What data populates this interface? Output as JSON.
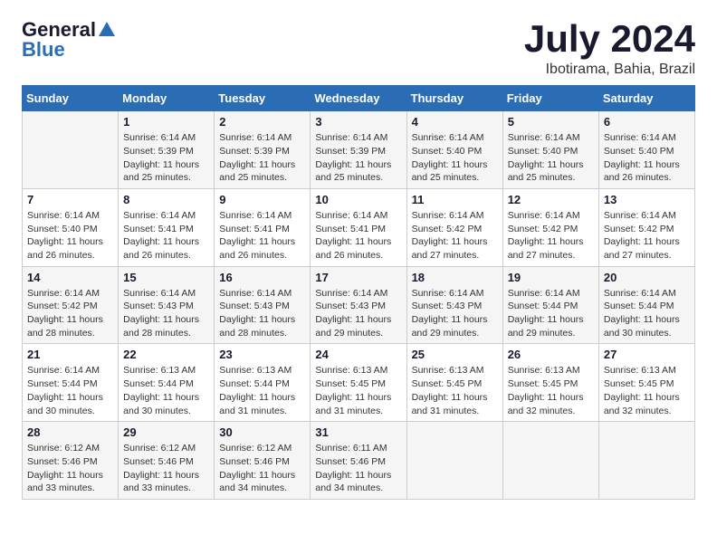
{
  "logo": {
    "general": "General",
    "blue": "Blue"
  },
  "title": {
    "month_year": "July 2024",
    "location": "Ibotirama, Bahia, Brazil"
  },
  "headers": [
    "Sunday",
    "Monday",
    "Tuesday",
    "Wednesday",
    "Thursday",
    "Friday",
    "Saturday"
  ],
  "weeks": [
    [
      {
        "day": "",
        "info": ""
      },
      {
        "day": "1",
        "info": "Sunrise: 6:14 AM\nSunset: 5:39 PM\nDaylight: 11 hours\nand 25 minutes."
      },
      {
        "day": "2",
        "info": "Sunrise: 6:14 AM\nSunset: 5:39 PM\nDaylight: 11 hours\nand 25 minutes."
      },
      {
        "day": "3",
        "info": "Sunrise: 6:14 AM\nSunset: 5:39 PM\nDaylight: 11 hours\nand 25 minutes."
      },
      {
        "day": "4",
        "info": "Sunrise: 6:14 AM\nSunset: 5:40 PM\nDaylight: 11 hours\nand 25 minutes."
      },
      {
        "day": "5",
        "info": "Sunrise: 6:14 AM\nSunset: 5:40 PM\nDaylight: 11 hours\nand 25 minutes."
      },
      {
        "day": "6",
        "info": "Sunrise: 6:14 AM\nSunset: 5:40 PM\nDaylight: 11 hours\nand 26 minutes."
      }
    ],
    [
      {
        "day": "7",
        "info": "Sunrise: 6:14 AM\nSunset: 5:40 PM\nDaylight: 11 hours\nand 26 minutes."
      },
      {
        "day": "8",
        "info": "Sunrise: 6:14 AM\nSunset: 5:41 PM\nDaylight: 11 hours\nand 26 minutes."
      },
      {
        "day": "9",
        "info": "Sunrise: 6:14 AM\nSunset: 5:41 PM\nDaylight: 11 hours\nand 26 minutes."
      },
      {
        "day": "10",
        "info": "Sunrise: 6:14 AM\nSunset: 5:41 PM\nDaylight: 11 hours\nand 26 minutes."
      },
      {
        "day": "11",
        "info": "Sunrise: 6:14 AM\nSunset: 5:42 PM\nDaylight: 11 hours\nand 27 minutes."
      },
      {
        "day": "12",
        "info": "Sunrise: 6:14 AM\nSunset: 5:42 PM\nDaylight: 11 hours\nand 27 minutes."
      },
      {
        "day": "13",
        "info": "Sunrise: 6:14 AM\nSunset: 5:42 PM\nDaylight: 11 hours\nand 27 minutes."
      }
    ],
    [
      {
        "day": "14",
        "info": "Sunrise: 6:14 AM\nSunset: 5:42 PM\nDaylight: 11 hours\nand 28 minutes."
      },
      {
        "day": "15",
        "info": "Sunrise: 6:14 AM\nSunset: 5:43 PM\nDaylight: 11 hours\nand 28 minutes."
      },
      {
        "day": "16",
        "info": "Sunrise: 6:14 AM\nSunset: 5:43 PM\nDaylight: 11 hours\nand 28 minutes."
      },
      {
        "day": "17",
        "info": "Sunrise: 6:14 AM\nSunset: 5:43 PM\nDaylight: 11 hours\nand 29 minutes."
      },
      {
        "day": "18",
        "info": "Sunrise: 6:14 AM\nSunset: 5:43 PM\nDaylight: 11 hours\nand 29 minutes."
      },
      {
        "day": "19",
        "info": "Sunrise: 6:14 AM\nSunset: 5:44 PM\nDaylight: 11 hours\nand 29 minutes."
      },
      {
        "day": "20",
        "info": "Sunrise: 6:14 AM\nSunset: 5:44 PM\nDaylight: 11 hours\nand 30 minutes."
      }
    ],
    [
      {
        "day": "21",
        "info": "Sunrise: 6:14 AM\nSunset: 5:44 PM\nDaylight: 11 hours\nand 30 minutes."
      },
      {
        "day": "22",
        "info": "Sunrise: 6:13 AM\nSunset: 5:44 PM\nDaylight: 11 hours\nand 30 minutes."
      },
      {
        "day": "23",
        "info": "Sunrise: 6:13 AM\nSunset: 5:44 PM\nDaylight: 11 hours\nand 31 minutes."
      },
      {
        "day": "24",
        "info": "Sunrise: 6:13 AM\nSunset: 5:45 PM\nDaylight: 11 hours\nand 31 minutes."
      },
      {
        "day": "25",
        "info": "Sunrise: 6:13 AM\nSunset: 5:45 PM\nDaylight: 11 hours\nand 31 minutes."
      },
      {
        "day": "26",
        "info": "Sunrise: 6:13 AM\nSunset: 5:45 PM\nDaylight: 11 hours\nand 32 minutes."
      },
      {
        "day": "27",
        "info": "Sunrise: 6:13 AM\nSunset: 5:45 PM\nDaylight: 11 hours\nand 32 minutes."
      }
    ],
    [
      {
        "day": "28",
        "info": "Sunrise: 6:12 AM\nSunset: 5:46 PM\nDaylight: 11 hours\nand 33 minutes."
      },
      {
        "day": "29",
        "info": "Sunrise: 6:12 AM\nSunset: 5:46 PM\nDaylight: 11 hours\nand 33 minutes."
      },
      {
        "day": "30",
        "info": "Sunrise: 6:12 AM\nSunset: 5:46 PM\nDaylight: 11 hours\nand 34 minutes."
      },
      {
        "day": "31",
        "info": "Sunrise: 6:11 AM\nSunset: 5:46 PM\nDaylight: 11 hours\nand 34 minutes."
      },
      {
        "day": "",
        "info": ""
      },
      {
        "day": "",
        "info": ""
      },
      {
        "day": "",
        "info": ""
      }
    ]
  ]
}
